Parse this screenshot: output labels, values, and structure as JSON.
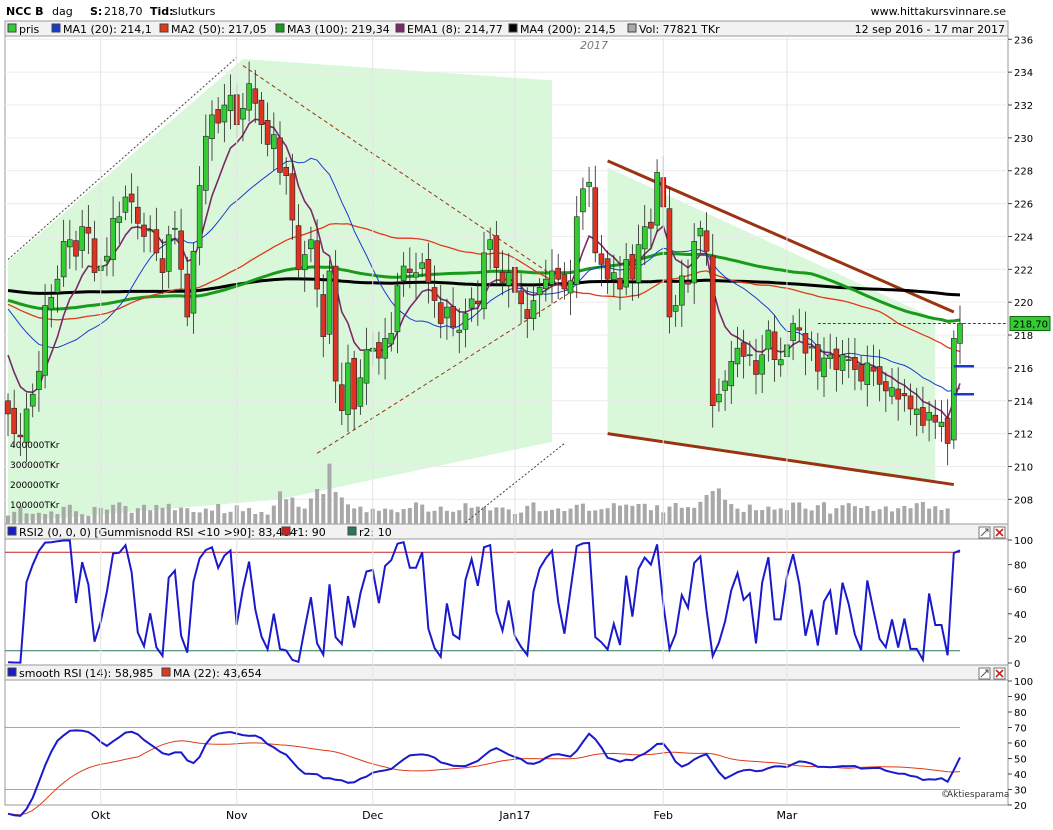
{
  "header": {
    "ticker": "NCC B",
    "period": "dag",
    "last_label": "S:",
    "last_value": "218,70",
    "type_label": "Tid:",
    "type_value": "slutkurs",
    "site": "www.hittakursvinnare.se",
    "date_range": "12 sep 2016 - 17 mar 2017"
  },
  "colors": {
    "price_up": "#33cc33",
    "price_down": "#dd3322",
    "ma1": "#1a3ccc",
    "ma2": "#e03a1a",
    "ma3": "#1a9a1a",
    "ema1": "#7a2a6a",
    "ma4": "#000000",
    "volume": "#a8a8a8",
    "trendline": "#993311",
    "rsi": "#1a1acc",
    "rsi_r1": "#cc2222",
    "rsi_r2": "#2a7a5a",
    "smooth_ma": "#e03a1a",
    "zone_fill": "#ccf5cc"
  },
  "price_legend": [
    {
      "label": "pris",
      "color": "#33cc33"
    },
    {
      "label": "MA1 (20): 214,1",
      "color": "#1a3ccc"
    },
    {
      "label": "MA2 (50): 217,05",
      "color": "#e03a1a"
    },
    {
      "label": "MA3 (100): 219,34",
      "color": "#1a9a1a"
    },
    {
      "label": "EMA1 (8): 214,77",
      "color": "#7a2a6a"
    },
    {
      "label": "MA4 (200): 214,5",
      "color": "#000000"
    },
    {
      "label": "Vol: 77821 TKr",
      "color": "#a8a8a8"
    }
  ],
  "rsi_legend": [
    {
      "label": "RSI2 (0, 0, 0) [Gummisnodd RSI <10 >90]: 83,484",
      "color": "#1a1acc"
    },
    {
      "label": "r1: 90",
      "color": "#cc2222"
    },
    {
      "label": "r2: 10",
      "color": "#2a7a5a"
    }
  ],
  "smooth_legend": [
    {
      "label": "smooth RSI (14): 58,985",
      "color": "#1a1acc"
    },
    {
      "label": "MA (22): 43,654",
      "color": "#e03a1a"
    }
  ],
  "year_marker": "2017",
  "last_price_tag": "218,70",
  "watermark": "Aktiesparama",
  "volume_labels": [
    "400000TKr",
    "300000TKr",
    "200000TKr",
    "100000TKr"
  ],
  "chart_data": {
    "type": "candlestick",
    "x_range": [
      "2016-09-12",
      "2017-03-17"
    ],
    "month_labels": [
      "Okt",
      "Nov",
      "Dec",
      "Jan17",
      "Feb",
      "Mar"
    ],
    "price_axis": {
      "ticks": [
        208,
        210,
        212,
        214,
        216,
        218,
        220,
        222,
        224,
        226,
        228,
        230,
        232,
        234,
        236
      ],
      "range": [
        206.5,
        236.2
      ]
    },
    "rsi_axis": {
      "ticks": [
        0,
        20,
        40,
        60,
        80,
        100
      ],
      "range": [
        0,
        100
      ]
    },
    "smooth_axis": {
      "ticks": [
        20,
        30,
        40,
        50,
        60,
        70,
        80,
        90,
        100
      ],
      "range": [
        20,
        100
      ]
    },
    "close": [
      213.2,
      212.0,
      211.8,
      213.5,
      214.4,
      215.8,
      219.8,
      220.3,
      221.4,
      223.7,
      223.8,
      222.8,
      224.6,
      224.2,
      221.8,
      222.2,
      222.8,
      225.1,
      225.2,
      226.4,
      226.1,
      224.8,
      224.0,
      224.4,
      223.0,
      221.8,
      224.1,
      224.5,
      222.0,
      219.1,
      223.1,
      227.1,
      230.1,
      231.4,
      230.9,
      232.0,
      232.6,
      230.8,
      231.8,
      233.3,
      232.1,
      230.8,
      229.6,
      230.2,
      227.9,
      227.7,
      225.0,
      222.0,
      222.9,
      223.8,
      220.8,
      217.9,
      221.9,
      215.2,
      213.4,
      216.3,
      213.5,
      215.4,
      217.1,
      217.2,
      216.6,
      217.8,
      218.1,
      221.0,
      222.2,
      221.8,
      221.8,
      222.4,
      221.2,
      220.1,
      218.7,
      219.7,
      218.5,
      218.3,
      219.3,
      220.2,
      219.9,
      223.0,
      223.8,
      222.1,
      221.2,
      221.8,
      220.6,
      219.9,
      219.0,
      220.1,
      220.9,
      221.4,
      221.9,
      221.4,
      220.8,
      221.3,
      225.2,
      226.9,
      227.3,
      223.0,
      222.3,
      221.4,
      221.8,
      220.8,
      222.6,
      221.4,
      223.5,
      224.6,
      224.5,
      227.9,
      225.8,
      219.1,
      219.8,
      221.6,
      221.1,
      223.7,
      224.5,
      223.1,
      213.7,
      214.4,
      215.2,
      216.4,
      217.2,
      216.7,
      216.8,
      215.6,
      216.8,
      218.3,
      216.5,
      216.5,
      217.4,
      218.7,
      218.3,
      216.9,
      217.3,
      215.8,
      216.6,
      216.8,
      215.9,
      216.8,
      216.5,
      215.9,
      215.2,
      216.3,
      215.8,
      215.0,
      214.6,
      214.8,
      214.1,
      214.3,
      213.5,
      213.5,
      212.5,
      213.3,
      212.7,
      212.7,
      211.4,
      217.8,
      218.7
    ],
    "volume_tkr": [
      42000,
      61000,
      88000,
      53000,
      51000,
      56000,
      50000,
      63000,
      50000,
      86000,
      96000,
      64000,
      49000,
      41000,
      85000,
      80000,
      72000,
      96000,
      108000,
      90000,
      56000,
      79000,
      96000,
      69000,
      95000,
      81000,
      101000,
      69000,
      82000,
      79000,
      60000,
      58000,
      77000,
      67000,
      100000,
      54000,
      61000,
      93000,
      64000,
      80000,
      50000,
      60000,
      47000,
      92000,
      163000,
      124000,
      132000,
      86000,
      77000,
      128000,
      175000,
      150000,
      302000,
      160000,
      133000,
      98000,
      78000,
      87000,
      59000,
      76000,
      66000,
      77000,
      72000,
      59000,
      75000,
      80000,
      108000,
      97000,
      62000,
      66000,
      87000,
      66000,
      61000,
      69000,
      104000,
      81000,
      87000,
      84000,
      68000,
      83000,
      82000,
      73000,
      50000,
      57000,
      91000,
      108000,
      64000,
      66000,
      71000,
      78000,
      65000,
      77000,
      96000,
      102000,
      66000,
      68000,
      74000,
      79000,
      104000,
      92000,
      97000,
      91000,
      100000,
      101000,
      69000,
      94000,
      58000,
      87000,
      105000,
      81000,
      85000,
      81000,
      111000,
      145000,
      165000,
      178000,
      121000,
      100000,
      77000,
      60000,
      97000,
      69000,
      70000,
      87000,
      72000,
      78000,
      69000,
      107000,
      108000,
      77000,
      68000,
      94000,
      109000,
      52000,
      79000,
      94000,
      104000,
      89000,
      80000,
      90000,
      66000,
      74000,
      88000,
      63000,
      79000,
      90000,
      79000,
      104000,
      110000,
      77000,
      89000,
      70000,
      77821
    ],
    "series": [
      {
        "name": "MA1 (20)",
        "last": 214.1
      },
      {
        "name": "MA2 (50)",
        "last": 217.05
      },
      {
        "name": "MA3 (100)",
        "last": 219.34
      },
      {
        "name": "EMA1 (8)",
        "last": 214.77
      },
      {
        "name": "MA4 (200)",
        "last": 214.5
      }
    ],
    "rsi2_last": 83.484,
    "rsi_bands": [
      90,
      10
    ],
    "smooth_rsi_last": 58.985,
    "smooth_ma_last": 43.654
  }
}
